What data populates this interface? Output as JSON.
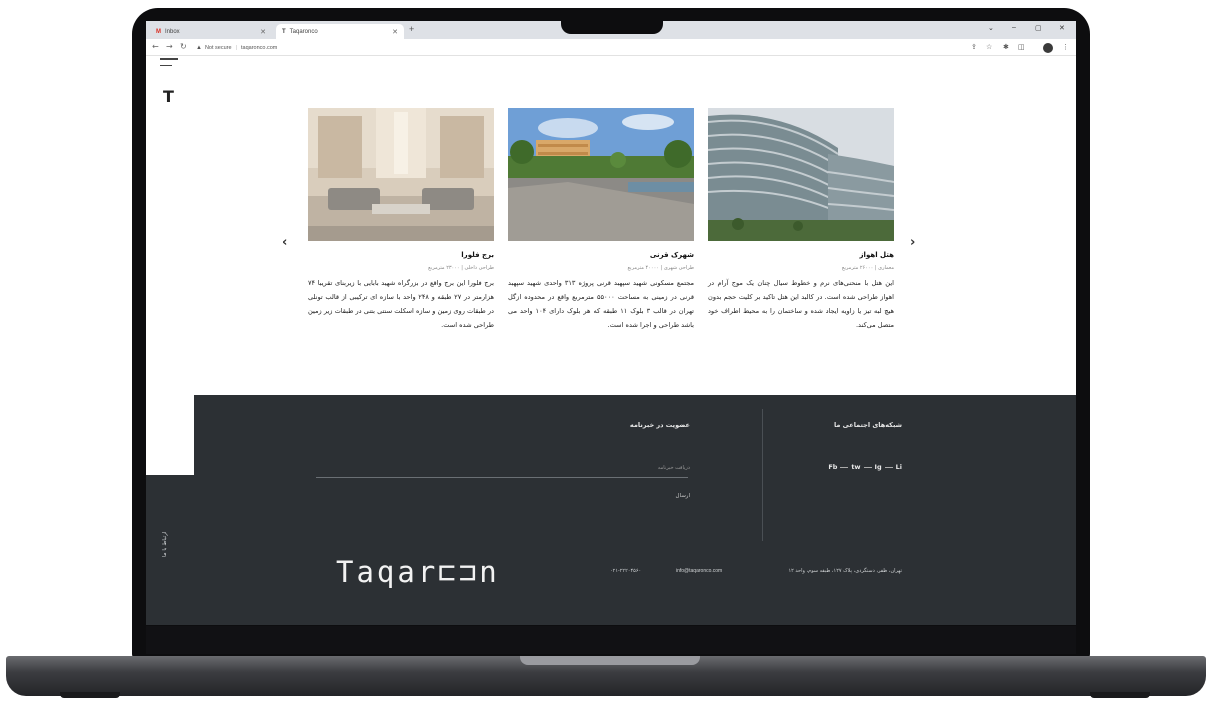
{
  "browser": {
    "tabs": [
      {
        "label": "Inbox"
      },
      {
        "label": "Taqaronco"
      }
    ],
    "new_tab": "+",
    "url": "taqaronco.com",
    "security": "Not secure",
    "window_controls": [
      "⌄",
      "–",
      "▢",
      "✕"
    ]
  },
  "sidebar": {
    "logo_letter": "T",
    "contact_label": "ارتباط با ما"
  },
  "carousel": {
    "prev_icon": "chevron-left-icon",
    "next_icon": "chevron-right-icon",
    "prev_glyph": "‹",
    "next_glyph": "›"
  },
  "projects": [
    {
      "title": "برج فلورا",
      "meta": "طراحی داخلی | ۲۳۰۰۰ مترمربع",
      "description": "برج فلورا این برج واقع در بزرگراه شهید بابایی با زیربنای تقریبا ۷۴ هزارمتر در ۲۷ طبقه و ۲۴۸ واحد با سازه ای ترکیبی از قالب تونلی در طبقات روی زمین و سازه اسکلت سنتی بتنی در طبقات زیر زمین طراحی شده است."
    },
    {
      "title": "شهرک قرنی",
      "meta": "طراحی شهری | ۴۰۰۰۰ مترمربع",
      "description": "مجتمع مسکونی شهید سپهبد قرنی پروژه ۳۱۳ واحدی شهید سپهبد قرنی در زمینی به مساحت ۵۵۰۰۰ مترمربع واقع در محدوده ازگل تهران در قالب ۳ بلوک ۱۱ طبقه که هر بلوک دارای ۱۰۴ واحد می باشد طراحی و اجرا شده است."
    },
    {
      "title": "هتل اهواز",
      "meta": "معماری | ۲۶۰۰۰ مترمربع",
      "description": "این هتل با منحنی‌های نرم و خطوط سیال چنان یک موج آرام در اهواز طراحی شده است. در کالبد این هتل تاکید بر کلیت حجم بدون هیچ لبه تیز یا زاویه ایجاد شده و ساختمان را به محیط اطراف خود متصل می‌کند."
    }
  ],
  "footer": {
    "social_heading": "شبکه‌های اجتماعی ما",
    "social_links": [
      "Fb",
      "tw",
      "Ig",
      "Li"
    ],
    "newsletter_heading": "عضویت در خبرنامه",
    "email_placeholder": "دریافت خبرنامه",
    "send_label": "ارسال",
    "brand": "Taqar⊏⊐n",
    "address": "تهران، ظفر، دستگردی، پلاک ۱۲۷، طبقه سوم، واحد ۱۲",
    "email": "info@taqaronco.com",
    "phone": "۰۲۱-۲۲۲۰۴۵۶۰"
  }
}
